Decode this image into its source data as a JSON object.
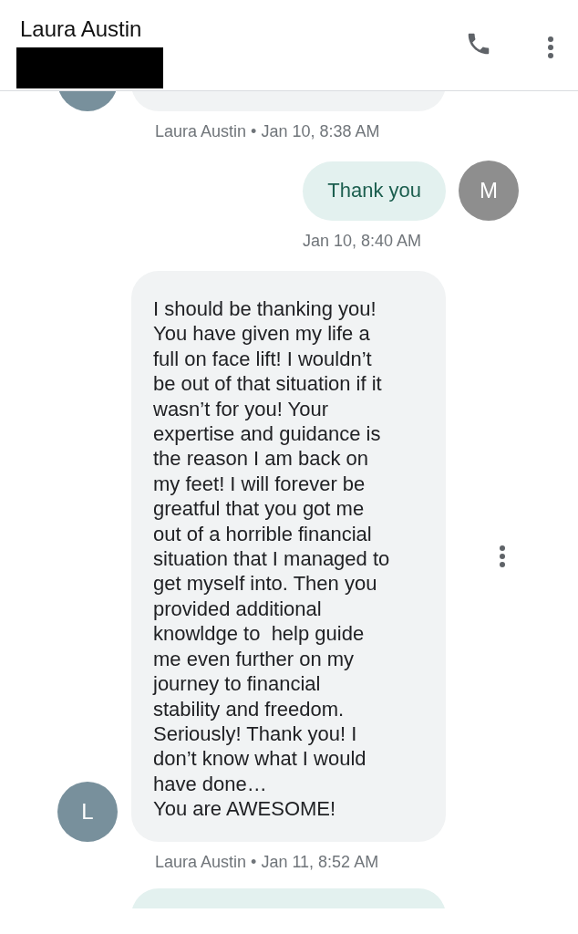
{
  "header": {
    "name": "Laura Austin",
    "redacted": true
  },
  "messages": [
    {
      "kind": "received_clipped_top",
      "avatar": {
        "color": "#78909c"
      },
      "meta": "Laura Austin • Jan 10, 8:38 AM"
    },
    {
      "kind": "sent",
      "text": "Thank you",
      "avatar": {
        "letter": "M",
        "color": "#8e8e8e"
      },
      "meta": "Jan 10, 8:40 AM"
    },
    {
      "kind": "received",
      "text": "I should be thanking you!\nYou have given my life a\nfull on face lift! I wouldn’t\nbe out of that situation if it\nwasn’t for you! Your\nexpertise and guidance is\nthe reason I am back on\nmy feet! I will forever be\ngreatful that you got me\nout of a horrible financial\nsituation that I managed to\nget myself into. Then you\nprovided additional\nknowldge to  help guide\nme even further on my\njourney to financial\nstability and freedom.\nSeriously! Thank you! I\ndon’t know what I would\nhave done…\nYou are AWESOME!",
      "avatar": {
        "letter": "L",
        "color": "#78909c"
      },
      "show_menu": true,
      "meta": "Laura Austin • Jan 11, 8:52 AM"
    },
    {
      "kind": "clipped_bottom",
      "color": "#e3f1ef"
    }
  ]
}
